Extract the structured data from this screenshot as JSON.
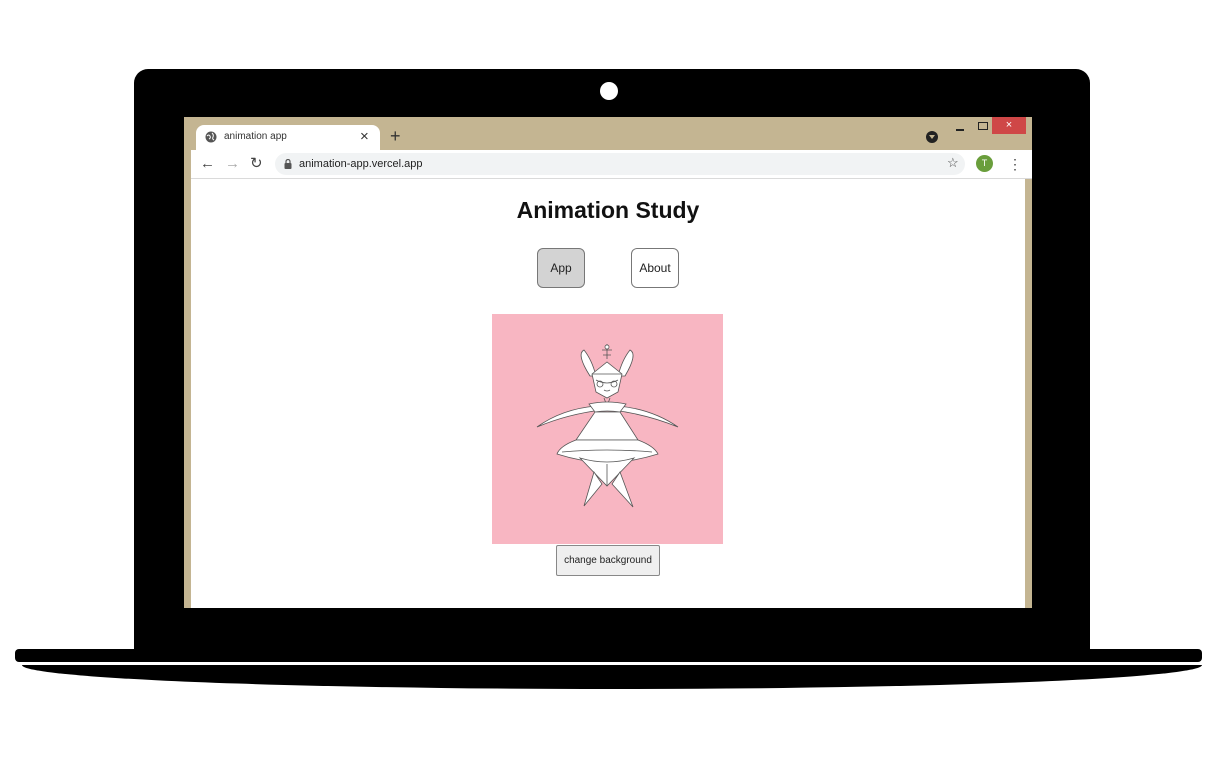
{
  "browser": {
    "tab_title": "animation app",
    "tab_close": "×",
    "new_tab": "+",
    "window_close": "×",
    "url": "animation-app.vercel.app",
    "bookmark_star": "☆",
    "profile_initial": "T",
    "back": "←",
    "forward": "→",
    "reload": "↻",
    "menu": "⋮"
  },
  "page": {
    "title": "Animation Study",
    "nav": [
      {
        "label": "App",
        "active": true
      },
      {
        "label": "About",
        "active": false
      }
    ],
    "stage_background": "#f8b6c2",
    "figure_description_icon": "dancer-figure",
    "change_background_label": "change background"
  },
  "colors": {
    "chrome_frame": "#c4b592",
    "window_close_red": "#cf4747",
    "avatar_green": "#6a9e3c",
    "active_nav": "#d3d3d3"
  }
}
